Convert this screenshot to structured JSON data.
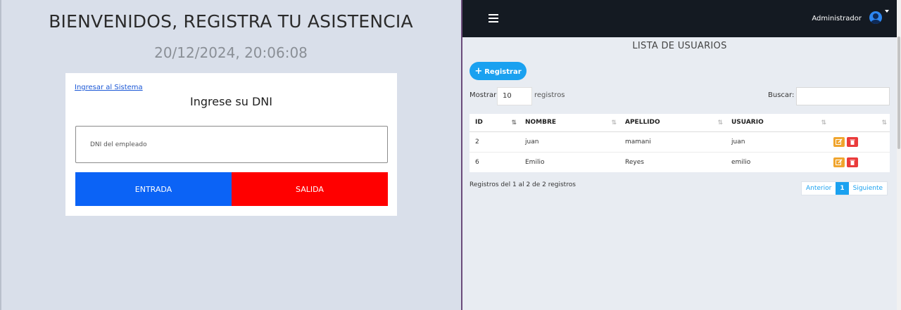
{
  "left": {
    "title": "BIENVENIDOS, REGISTRA TU ASISTENCIA",
    "clock": "20/12/2024, 20:06:08",
    "login_link": "Ingresar al Sistema",
    "dni_title": "Ingrese su DNI",
    "dni_placeholder": "DNI del empleado",
    "btn_entrada": "ENTRADA",
    "btn_salida": "SALIDA"
  },
  "topbar": {
    "menu_icon": "hamburger-icon",
    "user_name": "Administrador",
    "avatar_icon": "user-avatar-icon"
  },
  "users": {
    "title": "LISTA DE USUARIOS",
    "register_label": "Registrar",
    "show_label": "Mostrar",
    "show_value": "10",
    "show_suffix": "registros",
    "search_label": "Buscar:",
    "columns": [
      "ID",
      "NOMBRE",
      "APELLIDO",
      "USUARIO",
      ""
    ],
    "rows": [
      {
        "id": "2",
        "nombre": "juan",
        "apellido": "mamani",
        "usuario": "juan"
      },
      {
        "id": "6",
        "nombre": "Emilio",
        "apellido": "Reyes",
        "usuario": "emilio"
      }
    ],
    "info": "Registros del 1 al 2 de 2 registros",
    "pager": {
      "prev": "Anterior",
      "current": "1",
      "next": "Siguiente"
    }
  },
  "colors": {
    "entrada": "#0b63f6",
    "salida": "#ff0000",
    "accent": "#1aa1f0",
    "topbar": "#141a22",
    "edit": "#f0a52e",
    "delete": "#ea3b3b"
  }
}
